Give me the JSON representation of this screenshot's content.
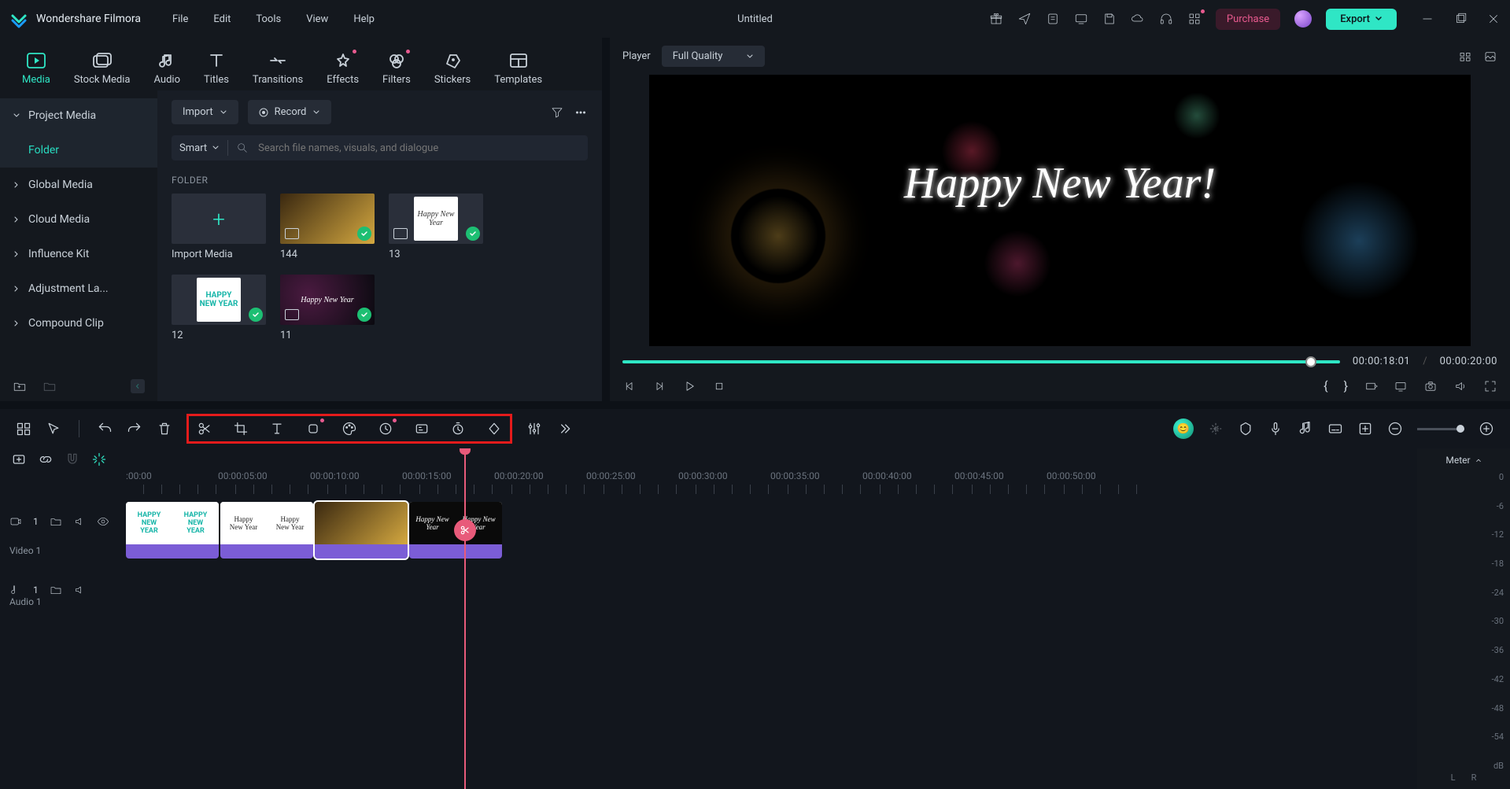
{
  "titlebar": {
    "app_name": "Wondershare Filmora",
    "menu": [
      "File",
      "Edit",
      "Tools",
      "View",
      "Help"
    ],
    "doc_title": "Untitled",
    "purchase": "Purchase",
    "export": "Export"
  },
  "tabs": [
    "Media",
    "Stock Media",
    "Audio",
    "Titles",
    "Transitions",
    "Effects",
    "Filters",
    "Stickers",
    "Templates"
  ],
  "sidebar": {
    "project_media": "Project Media",
    "folder": "Folder",
    "items": [
      "Global Media",
      "Cloud Media",
      "Influence Kit",
      "Adjustment La...",
      "Compound Clip"
    ]
  },
  "media_toolbar": {
    "import": "Import",
    "record": "Record",
    "search_mode": "Smart",
    "search_placeholder": "Search file names, visuals, and dialogue",
    "folder_label": "FOLDER",
    "import_media_label": "Import Media"
  },
  "thumbs": [
    {
      "label": "144",
      "text": "",
      "cls": ""
    },
    {
      "label": "13",
      "text": "Happy New Year",
      "cls": "fancy"
    },
    {
      "label": "12",
      "text": "HAPPY NEW YEAR",
      "cls": ""
    },
    {
      "label": "11",
      "text": "Happy New Year",
      "cls": "dark fancy"
    }
  ],
  "preview": {
    "player_label": "Player",
    "quality": "Full Quality",
    "overlay_text": "Happy New Year!",
    "current_time": "00:00:18:01",
    "total_time": "00:00:20:00"
  },
  "ruler": [
    ":00:00",
    "00:00:05:00",
    "00:00:10:00",
    "00:00:15:00",
    "00:00:20:00",
    "00:00:25:00",
    "00:00:30:00",
    "00:00:35:00",
    "00:00:40:00",
    "00:00:45:00",
    "00:00:50:00"
  ],
  "tracks": {
    "video_label": "Video 1",
    "video_num": "1",
    "audio_label": "Audio 1",
    "audio_num": "1"
  },
  "meter": {
    "label": "Meter",
    "db": "dB",
    "L": "L",
    "R": "R",
    "levels": [
      "0",
      "-6",
      "-12",
      "-18",
      "-24",
      "-30",
      "-36",
      "-42",
      "-48",
      "-54"
    ]
  }
}
